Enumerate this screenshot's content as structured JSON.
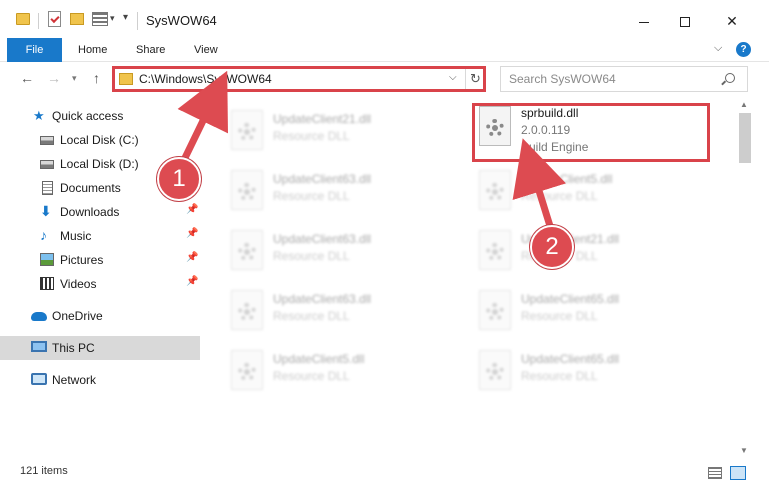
{
  "window": {
    "title": "SysWOW64",
    "minimize_icon": "minimize-icon",
    "maximize_icon": "maximize-icon",
    "close_label": "✕"
  },
  "ribbon": {
    "tabs": [
      {
        "label": "File"
      },
      {
        "label": "Home"
      },
      {
        "label": "Share"
      },
      {
        "label": "View"
      }
    ],
    "help_label": "?",
    "accent": "#1979ca"
  },
  "navigation": {
    "back": "←",
    "forward": "→",
    "dropdown": "▾",
    "up": "↑"
  },
  "address": {
    "path": "C:\\Windows\\SysWOW64",
    "dropdown": "⌵",
    "refresh": "↻"
  },
  "search": {
    "placeholder": "Search SysWOW64"
  },
  "sidebar": {
    "items": [
      {
        "label": "Quick access",
        "icon": "star-icon"
      },
      {
        "label": "Local Disk (C:)",
        "icon": "disk-icon"
      },
      {
        "label": "Local Disk (D:)",
        "icon": "disk-icon"
      },
      {
        "label": "Documents",
        "icon": "documents-icon"
      },
      {
        "label": "Downloads",
        "icon": "downloads-icon",
        "pin": "📌"
      },
      {
        "label": "Music",
        "icon": "music-icon",
        "pin": "📌"
      },
      {
        "label": "Pictures",
        "icon": "pictures-icon",
        "pin": "📌"
      },
      {
        "label": "Videos",
        "icon": "videos-icon",
        "pin": "📌"
      },
      {
        "label": "OneDrive",
        "icon": "onedrive-icon"
      },
      {
        "label": "This PC",
        "icon": "this-pc-icon",
        "selected": true
      },
      {
        "label": "Network",
        "icon": "network-icon"
      }
    ]
  },
  "files": {
    "left_column": [
      {
        "name": "UpdateClient21.dll",
        "desc": "Resource DLL"
      },
      {
        "name": "UpdateClient63.dll",
        "desc": "Resource DLL"
      },
      {
        "name": "UpdateClient63.dll",
        "desc": "Resource DLL"
      },
      {
        "name": "UpdateClient63.dll",
        "desc": "Resource DLL"
      },
      {
        "name": "UpdateClient5.dll",
        "desc": "Resource DLL"
      }
    ],
    "right_column": [
      {
        "name": "sprbuild.dll",
        "version": "2.0.0.119",
        "desc": "Build Engine",
        "highlighted": true
      },
      {
        "name": "UpdateClient5.dll",
        "desc": "Resource DLL"
      },
      {
        "name": "UpdateClient21.dll",
        "desc": "Resource DLL"
      },
      {
        "name": "UpdateClient65.dll",
        "desc": "Resource DLL"
      },
      {
        "name": "UpdateClient65.dll",
        "desc": "Resource DLL"
      }
    ]
  },
  "status": {
    "item_count": "121 items"
  },
  "annotations": {
    "step1": "1",
    "step2": "2",
    "color": "#dd4b51"
  },
  "scrollbar": {
    "up": "▲",
    "down": "▼"
  }
}
